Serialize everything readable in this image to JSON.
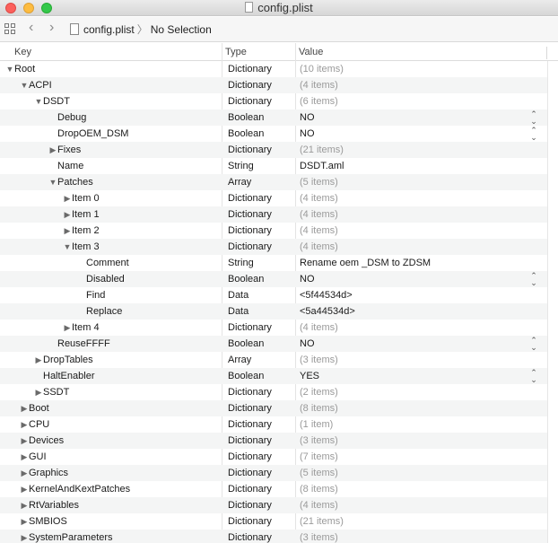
{
  "window": {
    "title": "config.plist"
  },
  "toolbar": {
    "file": "config.plist",
    "selection": "No Selection"
  },
  "columns": {
    "key": "Key",
    "type": "Type",
    "value": "Value"
  },
  "rows": [
    {
      "indent": 0,
      "disclosure": "open",
      "key": "Root",
      "type": "Dictionary",
      "value": "(10 items)",
      "muted": true,
      "popup": false
    },
    {
      "indent": 1,
      "disclosure": "open",
      "key": "ACPI",
      "type": "Dictionary",
      "value": "(4 items)",
      "muted": true,
      "popup": false
    },
    {
      "indent": 2,
      "disclosure": "open",
      "key": "DSDT",
      "type": "Dictionary",
      "value": "(6 items)",
      "muted": true,
      "popup": false
    },
    {
      "indent": 3,
      "disclosure": "none",
      "key": "Debug",
      "type": "Boolean",
      "value": "NO",
      "muted": false,
      "popup": true
    },
    {
      "indent": 3,
      "disclosure": "none",
      "key": "DropOEM_DSM",
      "type": "Boolean",
      "value": "NO",
      "muted": false,
      "popup": true
    },
    {
      "indent": 3,
      "disclosure": "closed",
      "key": "Fixes",
      "type": "Dictionary",
      "value": "(21 items)",
      "muted": true,
      "popup": false
    },
    {
      "indent": 3,
      "disclosure": "none",
      "key": "Name",
      "type": "String",
      "value": "DSDT.aml",
      "muted": false,
      "popup": false
    },
    {
      "indent": 3,
      "disclosure": "open",
      "key": "Patches",
      "type": "Array",
      "value": "(5 items)",
      "muted": true,
      "popup": false
    },
    {
      "indent": 4,
      "disclosure": "closed",
      "key": "Item 0",
      "type": "Dictionary",
      "value": "(4 items)",
      "muted": true,
      "popup": false
    },
    {
      "indent": 4,
      "disclosure": "closed",
      "key": "Item 1",
      "type": "Dictionary",
      "value": "(4 items)",
      "muted": true,
      "popup": false
    },
    {
      "indent": 4,
      "disclosure": "closed",
      "key": "Item 2",
      "type": "Dictionary",
      "value": "(4 items)",
      "muted": true,
      "popup": false
    },
    {
      "indent": 4,
      "disclosure": "open",
      "key": "Item 3",
      "type": "Dictionary",
      "value": "(4 items)",
      "muted": true,
      "popup": false
    },
    {
      "indent": 5,
      "disclosure": "none",
      "key": "Comment",
      "type": "String",
      "value": "Rename oem _DSM to ZDSM",
      "muted": false,
      "popup": false
    },
    {
      "indent": 5,
      "disclosure": "none",
      "key": "Disabled",
      "type": "Boolean",
      "value": "NO",
      "muted": false,
      "popup": true
    },
    {
      "indent": 5,
      "disclosure": "none",
      "key": "Find",
      "type": "Data",
      "value": "<5f44534d>",
      "muted": false,
      "popup": false
    },
    {
      "indent": 5,
      "disclosure": "none",
      "key": "Replace",
      "type": "Data",
      "value": "<5a44534d>",
      "muted": false,
      "popup": false
    },
    {
      "indent": 4,
      "disclosure": "closed",
      "key": "Item 4",
      "type": "Dictionary",
      "value": "(4 items)",
      "muted": true,
      "popup": false
    },
    {
      "indent": 3,
      "disclosure": "none",
      "key": "ReuseFFFF",
      "type": "Boolean",
      "value": "NO",
      "muted": false,
      "popup": true
    },
    {
      "indent": 2,
      "disclosure": "closed",
      "key": "DropTables",
      "type": "Array",
      "value": "(3 items)",
      "muted": true,
      "popup": false
    },
    {
      "indent": 2,
      "disclosure": "none",
      "key": "HaltEnabler",
      "type": "Boolean",
      "value": "YES",
      "muted": false,
      "popup": true
    },
    {
      "indent": 2,
      "disclosure": "closed",
      "key": "SSDT",
      "type": "Dictionary",
      "value": "(2 items)",
      "muted": true,
      "popup": false
    },
    {
      "indent": 1,
      "disclosure": "closed",
      "key": "Boot",
      "type": "Dictionary",
      "value": "(8 items)",
      "muted": true,
      "popup": false
    },
    {
      "indent": 1,
      "disclosure": "closed",
      "key": "CPU",
      "type": "Dictionary",
      "value": "(1 item)",
      "muted": true,
      "popup": false
    },
    {
      "indent": 1,
      "disclosure": "closed",
      "key": "Devices",
      "type": "Dictionary",
      "value": "(3 items)",
      "muted": true,
      "popup": false
    },
    {
      "indent": 1,
      "disclosure": "closed",
      "key": "GUI",
      "type": "Dictionary",
      "value": "(7 items)",
      "muted": true,
      "popup": false
    },
    {
      "indent": 1,
      "disclosure": "closed",
      "key": "Graphics",
      "type": "Dictionary",
      "value": "(5 items)",
      "muted": true,
      "popup": false
    },
    {
      "indent": 1,
      "disclosure": "closed",
      "key": "KernelAndKextPatches",
      "type": "Dictionary",
      "value": "(8 items)",
      "muted": true,
      "popup": false
    },
    {
      "indent": 1,
      "disclosure": "closed",
      "key": "RtVariables",
      "type": "Dictionary",
      "value": "(4 items)",
      "muted": true,
      "popup": false
    },
    {
      "indent": 1,
      "disclosure": "closed",
      "key": "SMBIOS",
      "type": "Dictionary",
      "value": "(21 items)",
      "muted": true,
      "popup": false
    },
    {
      "indent": 1,
      "disclosure": "closed",
      "key": "SystemParameters",
      "type": "Dictionary",
      "value": "(3 items)",
      "muted": true,
      "popup": false
    }
  ]
}
